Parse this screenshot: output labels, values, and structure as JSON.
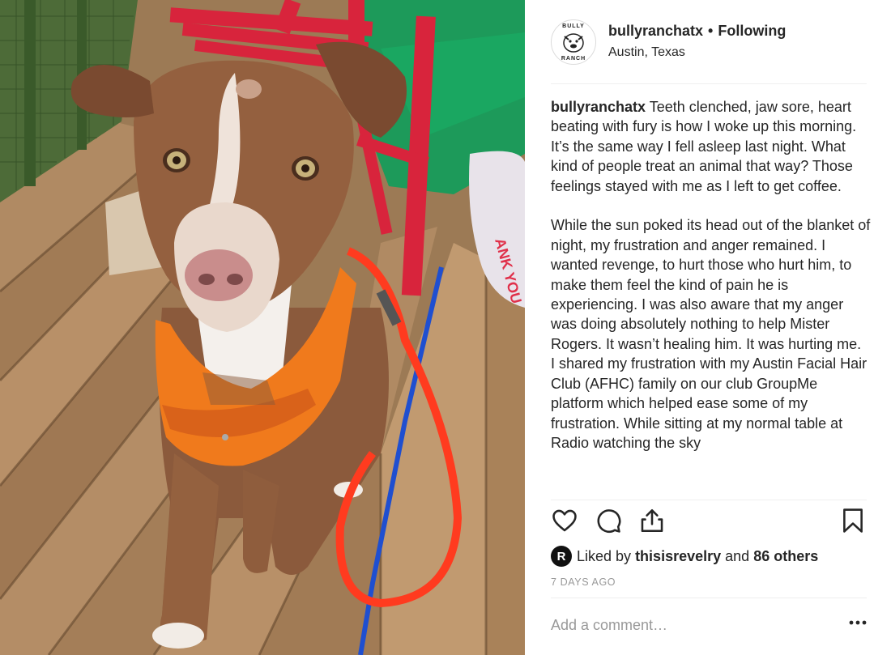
{
  "post": {
    "username": "bullyranchatx",
    "separator": "•",
    "follow_status": "Following",
    "location": "Austin, Texas",
    "avatar": {
      "text_top": "BULLY",
      "text_bottom": "RANCH",
      "icon": "bulldog-logo"
    }
  },
  "caption": {
    "username": "bullyranchatx",
    "paragraph_1": " Teeth clenched, jaw sore, heart beating with fury is how I woke up this morning. It’s the same way I fell asleep last night. What kind of people treat an animal that way? Those feelings stayed with me as I left to get coffee.",
    "paragraph_2": "While the sun poked its head out of the blanket of night, my frustration and anger remained. I wanted revenge, to hurt those who hurt him, to make them feel the kind of pain he is experiencing. I was also aware that my anger was doing absolutely nothing to help Mister Rogers. It wasn’t healing him. It was hurting me.",
    "paragraph_3": "I shared my frustration with my Austin Facial Hair Club (AFHC) family on our club GroupMe platform which helped ease some of my frustration. While sitting at my normal table at Radio watching the sky"
  },
  "actions": {
    "like_icon": "heart-icon",
    "comment_icon": "comment-bubble-icon",
    "share_icon": "share-icon",
    "save_icon": "bookmark-icon"
  },
  "likes": {
    "badge_letter": "R",
    "prefix": "Liked by",
    "liker": "thisisrevelry",
    "and_text": "and",
    "others": "86 others"
  },
  "timestamp": "7 DAYS AGO",
  "comment": {
    "placeholder": "Add a comment…",
    "more_icon": "ellipsis-icon"
  },
  "photo": {
    "subject": "dog-photo",
    "bag_text": "ANK YOU"
  },
  "colors": {
    "text": "#262626",
    "muted": "#999999",
    "divider": "#efefef",
    "harness": "#f07a1c",
    "leash": "#ff3b1f",
    "chair": "#d8243c"
  }
}
